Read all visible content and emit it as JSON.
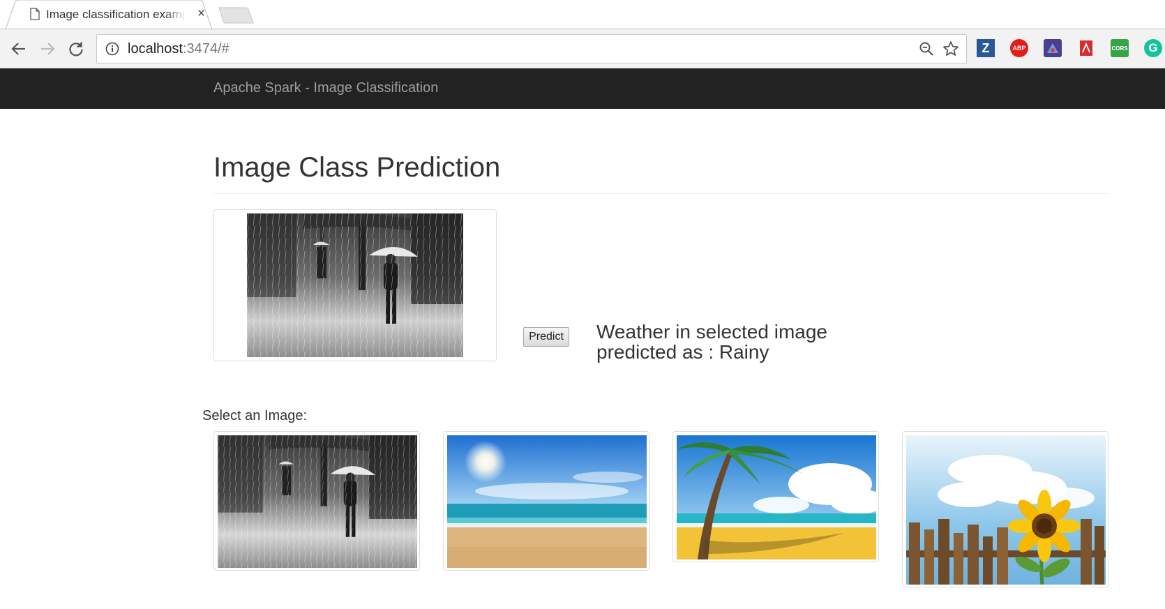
{
  "browser": {
    "tab": {
      "title": "Image classification example",
      "close_glyph": "×",
      "icon": "document-icon"
    },
    "address": {
      "host": "localhost",
      "rest": ":3474/#"
    },
    "extensions": [
      {
        "name": "zotero-extension-icon",
        "label": "Z",
        "color": "#2b5797"
      },
      {
        "name": "adblock-plus-extension-icon",
        "label": "ABP",
        "color": "#e41b17"
      },
      {
        "name": "spy-extension-icon",
        "label": "",
        "color": "#4b3f8f"
      },
      {
        "name": "pdf-extension-icon",
        "label": "",
        "color": "#d32f2f"
      },
      {
        "name": "cors-extension-icon",
        "label": "CORS",
        "color": "#3aa34a"
      },
      {
        "name": "grammarly-extension-icon",
        "label": "G",
        "color": "#15c39a"
      }
    ]
  },
  "navbar": {
    "brand": "Apache Spark - Image Classification"
  },
  "main": {
    "title": "Image Class Prediction",
    "predict_label": "Predict",
    "result_line1": "Weather in selected image",
    "result_line2": "predicted as : Rainy",
    "select_label": "Select an Image:"
  }
}
